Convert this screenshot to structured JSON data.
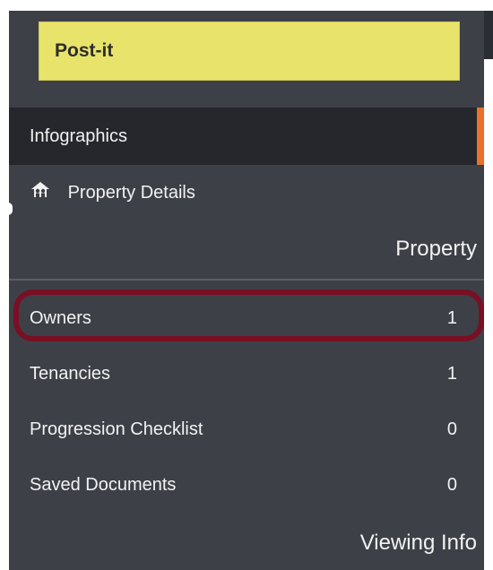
{
  "postit": {
    "label": "Post-it"
  },
  "nav": {
    "infographics": "Infographics",
    "property_details": "Property Details",
    "property_details_icon": "house-people-icon"
  },
  "sections": {
    "property": "Property",
    "viewing_info": "Viewing Info"
  },
  "items": [
    {
      "label": "Owners",
      "count": "1",
      "highlighted": true
    },
    {
      "label": "Tenancies",
      "count": "1"
    },
    {
      "label": "Progression Checklist",
      "count": "0"
    },
    {
      "label": "Saved Documents",
      "count": "0"
    }
  ],
  "colors": {
    "sidebar_bg": "#3d4047",
    "active_bg": "#25272c",
    "accent": "#e9712c",
    "postit": "#e8e36b",
    "highlight_ring": "#7a0f23"
  }
}
